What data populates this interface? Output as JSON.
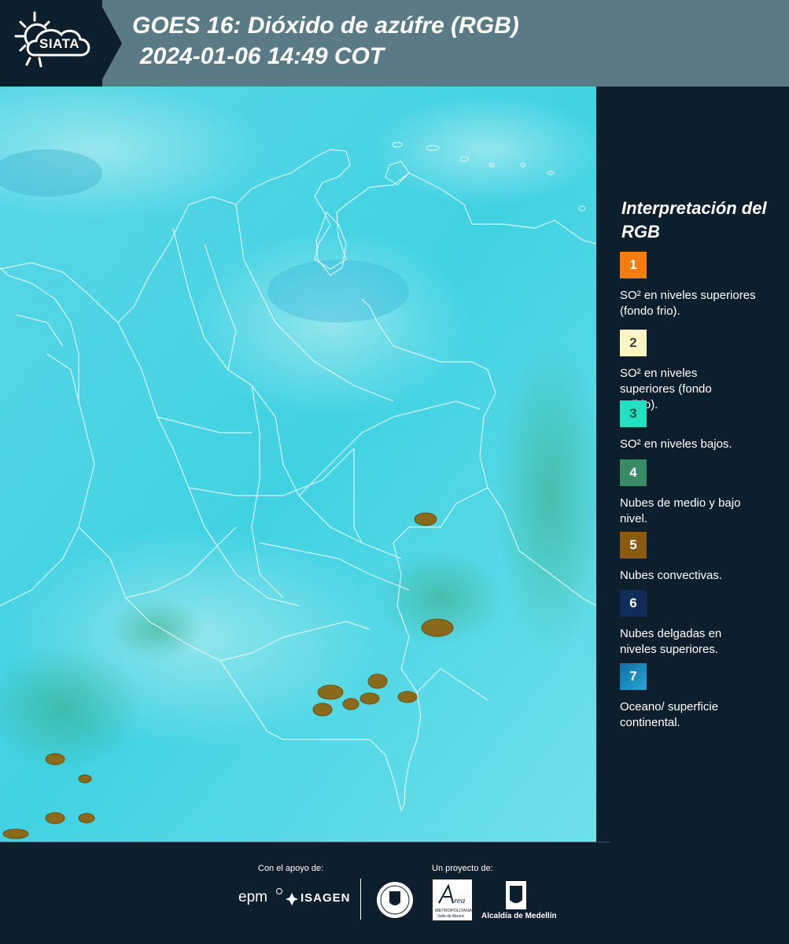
{
  "header": {
    "logo_text": "SIATA",
    "title_line1": "GOES 16: Dióxido de azúfre (RGB)",
    "title_line2": "2024-01-06 14:49 COT",
    "bg_color": "#5a7a86"
  },
  "map": {
    "description_colors": {
      "ocean_continental": "#4fd6e3",
      "convective": "#8a6a1a",
      "low_mid_clouds": "#3f9a6e"
    }
  },
  "legend": {
    "title": "Interpretación del RGB",
    "items": [
      {
        "number": "1",
        "color": "#f57c10",
        "text_color": "#ffffff",
        "label": "SO² en niveles superiores (fondo frio)."
      },
      {
        "number": "2",
        "color": "#fdf6c0",
        "text_color": "#444444",
        "label": "SO² en niveles superiores (fondo calido)."
      },
      {
        "number": "3",
        "color": "#22e0c0",
        "text_color": "#1a5a50",
        "label": "SO² en niveles bajos."
      },
      {
        "number": "4",
        "color": "#3a8a66",
        "text_color": "#ffffff",
        "label": "Nubes de medio y bajo nivel."
      },
      {
        "number": "5",
        "color": "#8a5a10",
        "text_color": "#ffffff",
        "label": "Nubes convectivas."
      },
      {
        "number": "6",
        "color": "#0f2c5a",
        "text_color": "#ffffff",
        "label": "Nubes delgadas en niveles superiores."
      },
      {
        "number": "7",
        "color": "#1a8fc0",
        "text_color": "#ffffff",
        "label": "Oceano/ superficie continental."
      }
    ]
  },
  "footer": {
    "support_label": "Con el apoyo de:",
    "project_label": "Un proyecto de:",
    "epm": "epm",
    "isagen": "ISAGEN",
    "area": "Área",
    "area_sub": "METROPOLITANA",
    "area_sub2": "Valle de Aburrá",
    "alcaldia": "Alcaldía de Medellín"
  }
}
